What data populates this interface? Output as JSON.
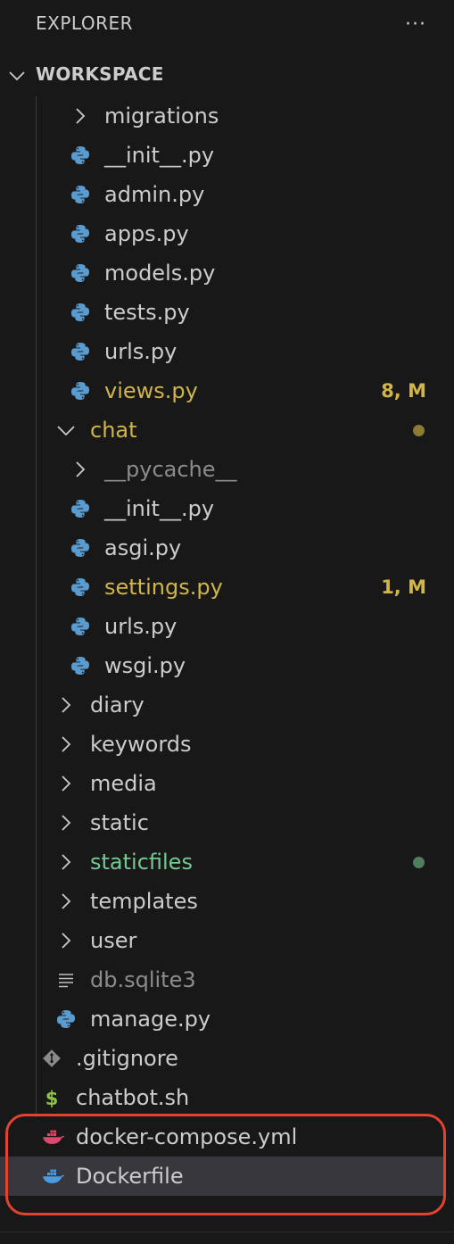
{
  "explorer": {
    "title": "EXPLORER",
    "more_actions": "···",
    "section": "WORKSPACE"
  },
  "colors": {
    "background": "#181818",
    "modified": "#d2b548",
    "untracked": "#73c991",
    "ignored": "#8c8c8c",
    "python_icon": "#5a9ccf",
    "docker_compose_icon": "#e0476d",
    "dockerfile_icon": "#4a9be0",
    "highlight": "#e2432f"
  },
  "items": [
    {
      "label": "migrations",
      "kind": "folder",
      "expanded": false,
      "level": 2,
      "icon": "chevron-right-icon"
    },
    {
      "label": "__init__.py",
      "kind": "file",
      "level": 2,
      "icon": "python-icon"
    },
    {
      "label": "admin.py",
      "kind": "file",
      "level": 2,
      "icon": "python-icon"
    },
    {
      "label": "apps.py",
      "kind": "file",
      "level": 2,
      "icon": "python-icon"
    },
    {
      "label": "models.py",
      "kind": "file",
      "level": 2,
      "icon": "python-icon"
    },
    {
      "label": "tests.py",
      "kind": "file",
      "level": 2,
      "icon": "python-icon"
    },
    {
      "label": "urls.py",
      "kind": "file",
      "level": 2,
      "icon": "python-icon"
    },
    {
      "label": "views.py",
      "kind": "file",
      "level": 2,
      "icon": "python-icon",
      "status": "modified",
      "badge": "8, M"
    },
    {
      "label": "chat",
      "kind": "folder",
      "expanded": true,
      "level": 1,
      "icon": "chevron-down-icon",
      "status": "modified",
      "dot": true
    },
    {
      "label": "__pycache__",
      "kind": "folder",
      "expanded": false,
      "level": 2,
      "icon": "chevron-right-icon",
      "status": "ignored"
    },
    {
      "label": "__init__.py",
      "kind": "file",
      "level": 2,
      "icon": "python-icon"
    },
    {
      "label": "asgi.py",
      "kind": "file",
      "level": 2,
      "icon": "python-icon"
    },
    {
      "label": "settings.py",
      "kind": "file",
      "level": 2,
      "icon": "python-icon",
      "status": "modified",
      "badge": "1, M"
    },
    {
      "label": "urls.py",
      "kind": "file",
      "level": 2,
      "icon": "python-icon"
    },
    {
      "label": "wsgi.py",
      "kind": "file",
      "level": 2,
      "icon": "python-icon"
    },
    {
      "label": "diary",
      "kind": "folder",
      "expanded": false,
      "level": 1,
      "icon": "chevron-right-icon"
    },
    {
      "label": "keywords",
      "kind": "folder",
      "expanded": false,
      "level": 1,
      "icon": "chevron-right-icon"
    },
    {
      "label": "media",
      "kind": "folder",
      "expanded": false,
      "level": 1,
      "icon": "chevron-right-icon"
    },
    {
      "label": "static",
      "kind": "folder",
      "expanded": false,
      "level": 1,
      "icon": "chevron-right-icon"
    },
    {
      "label": "staticfiles",
      "kind": "folder",
      "expanded": false,
      "level": 1,
      "icon": "chevron-right-icon",
      "status": "untracked",
      "dot": true
    },
    {
      "label": "templates",
      "kind": "folder",
      "expanded": false,
      "level": 1,
      "icon": "chevron-right-icon"
    },
    {
      "label": "user",
      "kind": "folder",
      "expanded": false,
      "level": 1,
      "icon": "chevron-right-icon"
    },
    {
      "label": "db.sqlite3",
      "kind": "file",
      "level": 1,
      "icon": "lines-file-icon",
      "status": "ignored"
    },
    {
      "label": "manage.py",
      "kind": "file",
      "level": 1,
      "icon": "python-icon"
    },
    {
      "label": ".gitignore",
      "kind": "file",
      "level": 0,
      "icon": "git-icon"
    },
    {
      "label": "chatbot.sh",
      "kind": "file",
      "level": 0,
      "icon": "dollar-icon"
    },
    {
      "label": "docker-compose.yml",
      "kind": "file",
      "level": 0,
      "icon": "docker-compose-icon"
    },
    {
      "label": "Dockerfile",
      "kind": "file",
      "level": 0,
      "icon": "docker-icon",
      "selected": true
    }
  ]
}
